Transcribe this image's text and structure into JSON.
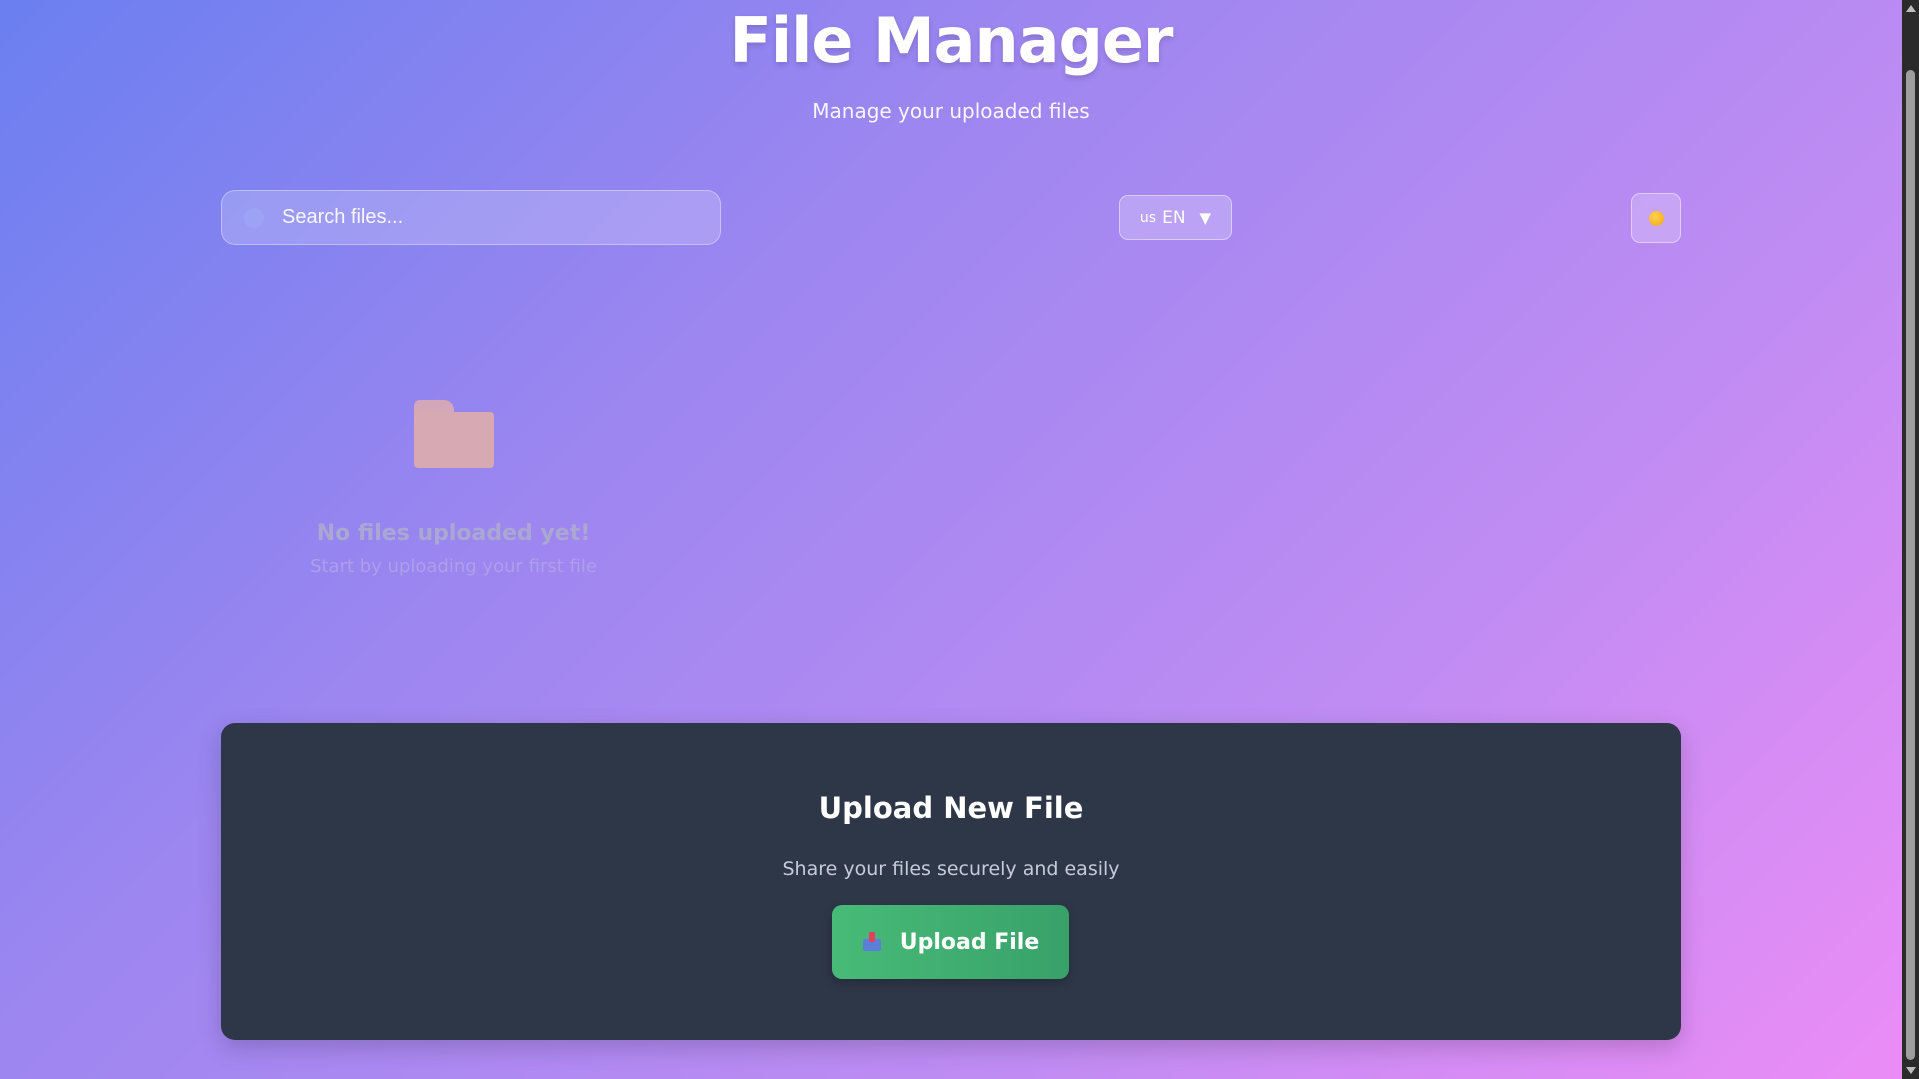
{
  "header": {
    "title": "File Manager",
    "subtitle": "Manage your uploaded files"
  },
  "toolbar": {
    "search_placeholder": "Search files...",
    "language": {
      "flag": "us",
      "code": "EN",
      "caret": "▼"
    },
    "theme_toggle_icon": "sun-icon"
  },
  "empty_state": {
    "icon": "folder-icon",
    "title": "No files uploaded yet!",
    "subtitle": "Start by uploading your first file"
  },
  "upload": {
    "title": "Upload New File",
    "subtitle": "Share your files securely and easily",
    "button_label": "Upload File",
    "button_icon": "inbox-tray-icon"
  },
  "colors": {
    "background_start": "#6b7ff0",
    "background_end": "#ec8cf6",
    "card": "#2e3748",
    "button": "#48bb78"
  }
}
